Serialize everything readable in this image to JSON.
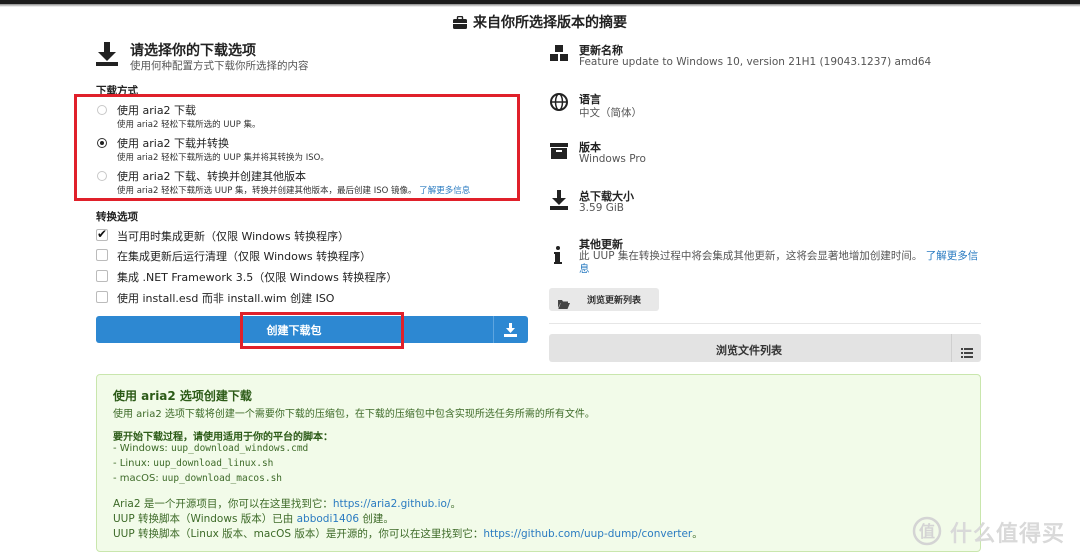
{
  "page": {
    "title": "来自你所选择版本的摘要"
  },
  "download": {
    "heading": "请选择你的下载选项",
    "subheading": "使用何种配置方式下载你所选择的内容",
    "method_label": "下载方式",
    "options": [
      {
        "label": "使用 aria2 下载",
        "desc": "使用 aria2 轻松下载所选的 UUP 集。",
        "checked": false
      },
      {
        "label": "使用 aria2 下载并转换",
        "desc": "使用 aria2 轻松下载所选的 UUP 集并将其转换为 ISO。",
        "checked": true
      },
      {
        "label": "使用 aria2 下载、转换并创建其他版本",
        "desc": "使用 aria2 轻松下载所选 UUP 集，转换并创建其他版本，最后创建 ISO 镜像。",
        "link": "了解更多信息",
        "checked": false
      }
    ],
    "convert_label": "转换选项",
    "convert_options": [
      {
        "label": "当可用时集成更新（仅限 Windows 转换程序）",
        "checked": true
      },
      {
        "label": "在集成更新后运行清理（仅限 Windows 转换程序）",
        "checked": false
      },
      {
        "label": "集成 .NET Framework 3.5（仅限 Windows 转换程序）",
        "checked": false
      },
      {
        "label": "使用 install.esd 而非 install.wim 创建 ISO",
        "checked": false
      }
    ],
    "create_button": "创建下载包"
  },
  "summary": {
    "update_name_title": "更新名称",
    "update_name_value": "Feature update to Windows 10, version 21H1 (19043.1237) amd64",
    "language_title": "语言",
    "language_value": "中文（简体）",
    "edition_title": "版本",
    "edition_value": "Windows Pro",
    "size_title": "总下载大小",
    "size_value": "3.59 GiB",
    "other_title": "其他更新",
    "other_value": "此 UUP 集在转换过程中将会集成其他更新，这将会显著地增加创建时间。",
    "other_link": "了解更多信息",
    "browse_updates_button": "浏览更新列表",
    "browse_files_button": "浏览文件列表"
  },
  "info": {
    "title": "使用 aria2 选项创建下载",
    "desc": "使用 aria2 选项下载将创建一个需要你下载的压缩包，在下载的压缩包中包含实现所选任务所需的所有文件。",
    "scripts_heading": "要开始下载过程，请使用适用于你的平台的脚本：",
    "windows_label": "- Windows: ",
    "windows_script": "uup_download_windows.cmd",
    "linux_label": "- Linux: ",
    "linux_script": "uup_download_linux.sh",
    "macos_label": "- macOS: ",
    "macos_script": "uup_download_macos.sh",
    "aria2_line": "Aria2 是一个开源项目，你可以在这里找到它：",
    "aria2_url": "https://aria2.github.io/",
    "aria2_end": "。",
    "win_converter_line": "UUP 转换脚本（Windows 版本）已由 ",
    "win_converter_author": "abbodi1406",
    "win_converter_end": " 创建。",
    "linux_converter_line": "UUP 转换脚本（Linux 版本、macOS 版本）是开源的，你可以在这里找到它：",
    "linux_converter_url": "https://github.com/uup-dump/converter",
    "linux_converter_end": "。"
  },
  "watermark": {
    "text": "什么值得买"
  },
  "colors": {
    "primary": "#2d88d2",
    "highlight": "#e0202a",
    "success_bg": "#f2fbe9"
  }
}
